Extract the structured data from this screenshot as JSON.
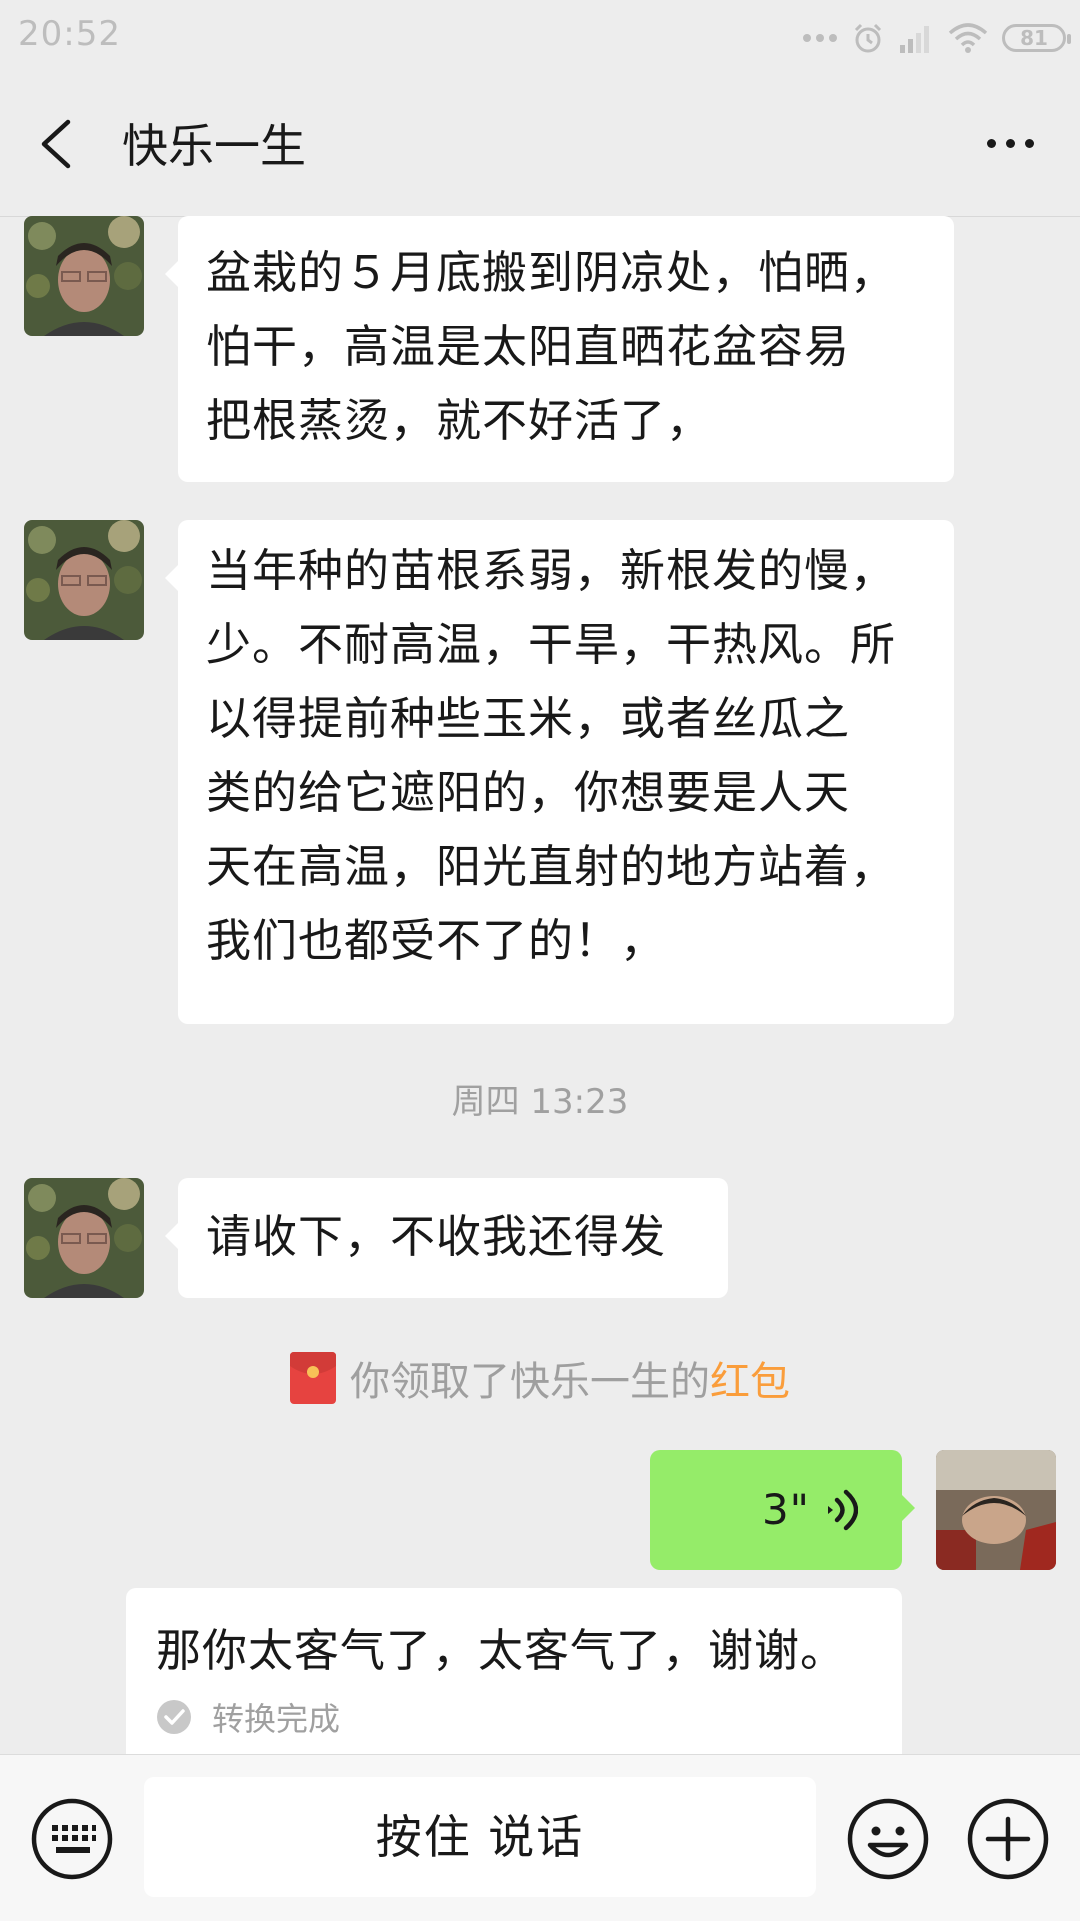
{
  "status_bar": {
    "time": "20:52",
    "battery": "81"
  },
  "header": {
    "title": "快乐一生"
  },
  "messages": [
    {
      "sender": "other",
      "lines": [
        "盆栽的５月底搬到阴凉处，怕晒，",
        "怕干，高温是太阳直晒花盆容易",
        "把根蒸烫，就不好活了，"
      ]
    },
    {
      "sender": "other",
      "lines": [
        "当年种的苗根系弱，新根发的慢，",
        "少。不耐高温，干旱，干热风。所",
        "以得提前种些玉米，或者丝瓜之",
        "类的给它遮阳的，你想要是人天",
        "天在高温，阳光直射的地方站着，",
        "我们也都受不了的！，"
      ]
    },
    {
      "sender": "other",
      "lines": [
        "请收下，不收我还得发"
      ]
    }
  ],
  "timestamp": "周四 13:23",
  "red_packet_notice": {
    "prefix": "你领取了快乐一生的",
    "highlight": "红包"
  },
  "voice_message": {
    "duration": "3\""
  },
  "transcript": {
    "text": "那你太客气了，太客气了，谢谢。",
    "status": "转换完成"
  },
  "input_bar": {
    "talk_label": "按住 说话"
  },
  "colors": {
    "background": "#ededed",
    "self_bubble": "#95ec69",
    "red_packet_link": "#fa9d3b"
  }
}
